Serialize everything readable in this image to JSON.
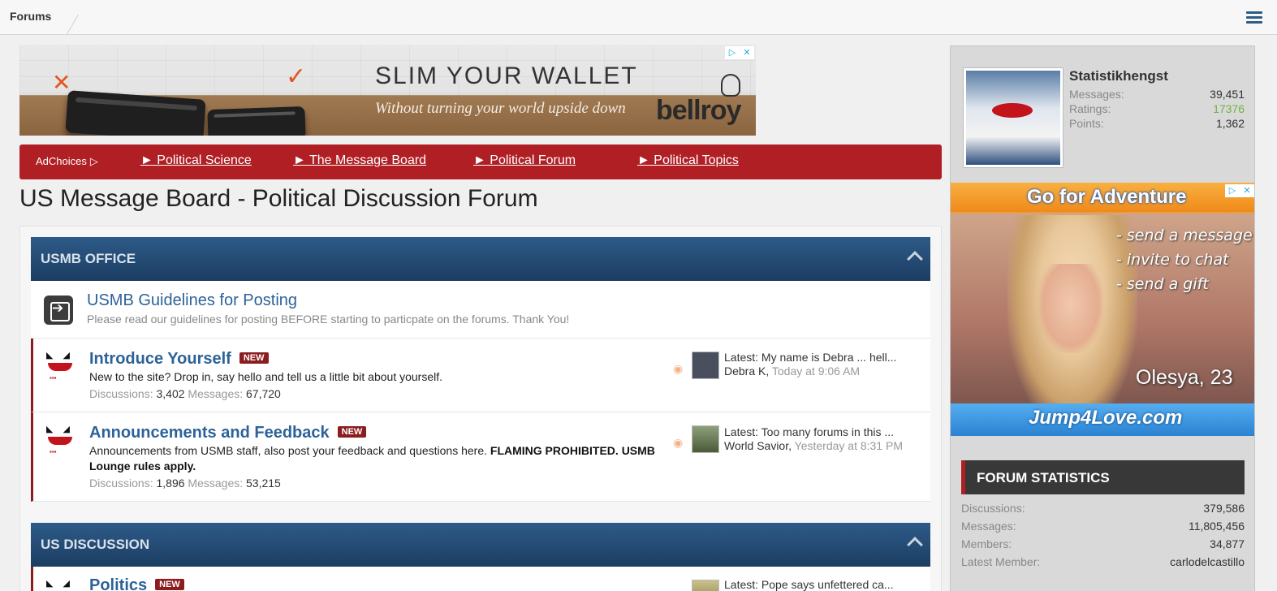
{
  "topbar": {
    "breadcrumb": "Forums"
  },
  "banner_ad": {
    "headline": "SLIM YOUR WALLET",
    "subline": "Without turning your world upside down",
    "brand": "bellroy"
  },
  "nav": {
    "adchoices": "AdChoices",
    "links": [
      "► Political Science",
      "► The Message Board",
      "► Political Forum",
      "► Political Topics"
    ]
  },
  "page_title": "US Message Board - Political Discussion Forum",
  "categories": [
    {
      "title": "USMB OFFICE"
    },
    {
      "title": "US DISCUSSION"
    }
  ],
  "forums": [
    {
      "title": "USMB Guidelines for Posting",
      "description": "Please read our guidelines for posting BEFORE starting to particpate on the forums. Thank You!"
    },
    {
      "title": "Introduce Yourself",
      "badge": "NEW",
      "description": "New to the site? Drop in, say hello and tell us a little bit about yourself.",
      "discussions_label": "Discussions:",
      "discussions": "3,402",
      "messages_label": "Messages:",
      "messages": "67,720",
      "latest": "Latest: My name is Debra ... hell...",
      "latest_user": "Debra K,",
      "latest_time": "Today at 9:06 AM"
    },
    {
      "title": "Announcements and Feedback",
      "badge": "NEW",
      "description": "Announcements from USMB staff, also post your feedback and questions here.",
      "description_bold": "FLAMING PROHIBITED.",
      "description_bold2": "USMB Lounge rules apply.",
      "discussions_label": "Discussions:",
      "discussions": "1,896",
      "messages_label": "Messages:",
      "messages": "53,215",
      "latest": "Latest: Too many forums in this ...",
      "latest_user": "World Savior,",
      "latest_time": "Yesterday at 8:31 PM"
    },
    {
      "title": "Politics",
      "badge": "NEW",
      "latest": "Latest: Pope says unfettered ca..."
    }
  ],
  "sidebar": {
    "user": {
      "name": "Statistikhengst",
      "messages_label": "Messages:",
      "messages": "39,451",
      "ratings_label": "Ratings:",
      "ratings": "17376",
      "points_label": "Points:",
      "points": "1,362"
    },
    "ad": {
      "headline": "Go for Adventure",
      "lines": [
        "- send a message",
        "- invite to chat",
        "- send a gift"
      ],
      "name": "Olesya, 23",
      "site": "Jump4Love.com"
    },
    "stats": {
      "title": "FORUM STATISTICS",
      "rows": [
        {
          "label": "Discussions:",
          "value": "379,586"
        },
        {
          "label": "Messages:",
          "value": "11,805,456"
        },
        {
          "label": "Members:",
          "value": "34,877"
        },
        {
          "label": "Latest Member:",
          "value": "carlodelcastillo"
        }
      ]
    }
  },
  "colors": {
    "accent_red": "#b01f24",
    "category_blue": "#1c3d62",
    "link_blue": "#2d6299",
    "rating_green": "#6cb33f"
  }
}
